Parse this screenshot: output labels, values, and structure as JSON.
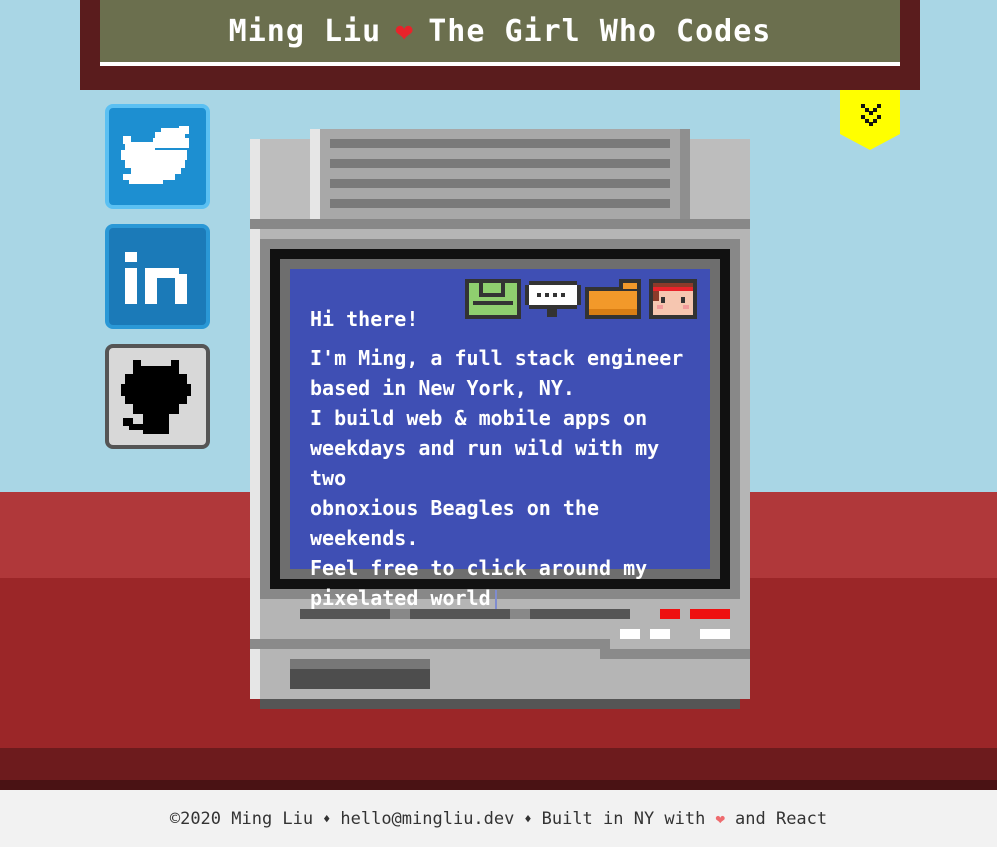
{
  "header": {
    "name": "Ming Liu",
    "heart": "❤",
    "tagline": "The Girl Who Codes"
  },
  "bookmark": {
    "icon": "double-chevron-down-icon",
    "color": "#ffff00"
  },
  "social": [
    {
      "icon": "twitter-icon"
    },
    {
      "icon": "linkedin-icon"
    },
    {
      "icon": "github-icon"
    }
  ],
  "screen": {
    "greeting": "Hi there!",
    "bio": "I'm Ming, a full stack engineer\nbased in New York, NY.\nI build web & mobile apps on\nweekdays and run wild with my two\nobnoxious Beagles on the weekends.\nFeel free to click around my\npixelated world",
    "icons": [
      "floppy-disk-icon",
      "speech-bubble-icon",
      "folder-icon",
      "avatar-icon"
    ]
  },
  "footer": {
    "copyright": "©2020 Ming Liu",
    "sep1": "♦",
    "email": "hello@mingliu.dev",
    "sep2": "♦",
    "built": "Built in NY with",
    "heart": "❤",
    "react": "and React"
  },
  "colors": {
    "sky": "#a9d6e5",
    "sign": "#6b6f4e",
    "screen": "#3f4fb4",
    "desk": "#9b2628"
  }
}
